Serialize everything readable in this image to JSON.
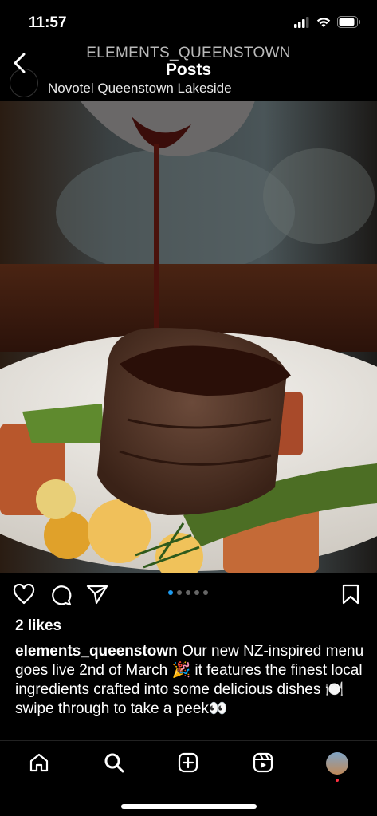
{
  "status": {
    "time": "11:57"
  },
  "header": {
    "account": "ELEMENTS_QUEENSTOWN",
    "title": "Posts"
  },
  "post": {
    "location": "Novotel Queenstown Lakeside",
    "likes": "2 likes",
    "username": "elements_queenstown",
    "caption_text": "Our new NZ-inspired menu goes live 2nd of March 🎉 it features the finest local ingredients crafted into some delicious dishes 🍽️ swipe through to take a peek👀",
    "carousel_index": 1,
    "carousel_count": 5
  },
  "colors": {
    "accent": "#1d9bf0",
    "background": "#000000",
    "notification_dot": "#ff3040"
  },
  "tabs": [
    "home-icon",
    "search-icon",
    "create-icon",
    "reels-icon",
    "profile-avatar"
  ]
}
